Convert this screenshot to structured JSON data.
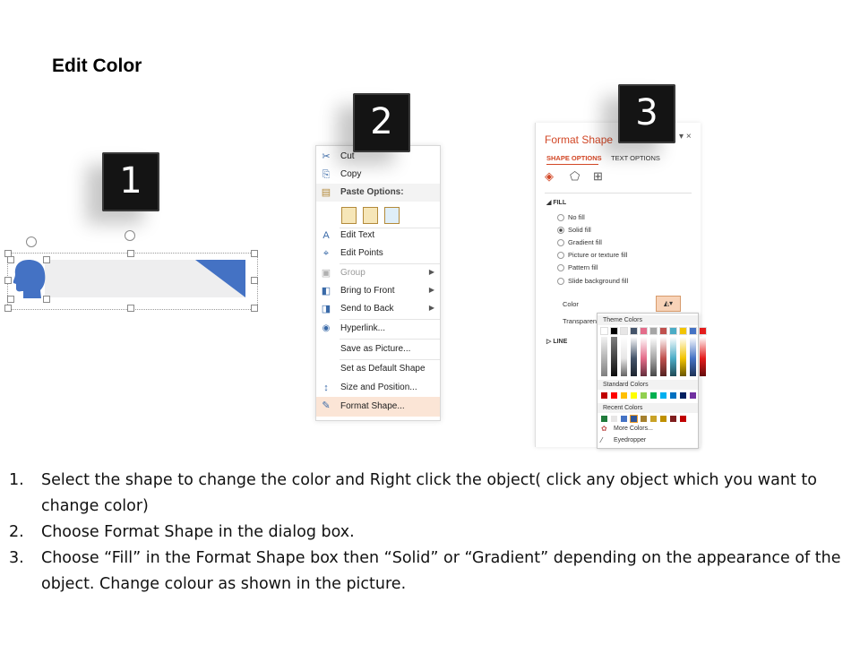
{
  "title": "Edit Color",
  "badges": [
    "1",
    "2",
    "3"
  ],
  "context_menu": {
    "items": [
      {
        "label": "Cut",
        "icon": "scissors-icon",
        "glyph": "✂"
      },
      {
        "label": "Copy",
        "icon": "copy-icon",
        "glyph": "⎘"
      },
      {
        "label": "Paste Options:",
        "icon": "paste-icon",
        "glyph": "📋"
      },
      {
        "label": "Edit Text",
        "icon": "edit-text-icon",
        "glyph": "A"
      },
      {
        "label": "Edit Points",
        "icon": "edit-points-icon",
        "glyph": "⌖"
      },
      {
        "label": "Group",
        "icon": "group-icon",
        "glyph": "▣"
      },
      {
        "label": "Bring to Front",
        "icon": "bring-front-icon",
        "glyph": "◧"
      },
      {
        "label": "Send to Back",
        "icon": "send-back-icon",
        "glyph": "◨"
      },
      {
        "label": "Hyperlink...",
        "icon": "hyperlink-icon",
        "glyph": "🌐"
      },
      {
        "label": "Save as Picture...",
        "icon": "",
        "glyph": ""
      },
      {
        "label": "Set as Default Shape",
        "icon": "",
        "glyph": ""
      },
      {
        "label": "Size and Position...",
        "icon": "size-position-icon",
        "glyph": "↕"
      },
      {
        "label": "Format Shape...",
        "icon": "format-shape-icon",
        "glyph": "✎"
      }
    ]
  },
  "format_pane": {
    "title": "Format Shape",
    "close": "×",
    "tabs": [
      "SHAPE OPTIONS",
      "TEXT OPTIONS"
    ],
    "fill_section": "FILL",
    "fill_options": [
      "No fill",
      "Solid fill",
      "Gradient fill",
      "Picture or texture fill",
      "Pattern fill",
      "Slide background fill"
    ],
    "selected_fill": "Solid fill",
    "color_label": "Color",
    "transparency_label": "Transparency",
    "line_section": "LINE"
  },
  "palette": {
    "theme_header": "Theme Colors",
    "standard_header": "Standard Colors",
    "recent_header": "Recent Colors",
    "more_colors": "More Colors...",
    "eyedropper": "Eyedropper",
    "theme_top": [
      "#ffffff",
      "#000000",
      "#e7e6e6",
      "#44546a",
      "#e46c8a",
      "#a5a5a5",
      "#c0504d",
      "#4bacc6",
      "#f2c400",
      "#4472c4",
      "#e41b1b"
    ],
    "standard": [
      "#c00000",
      "#ff0000",
      "#ffc000",
      "#ffff00",
      "#92d050",
      "#00b050",
      "#00b0f0",
      "#0070c0",
      "#002060",
      "#7030a0"
    ],
    "recent": [
      "#1f7a3a",
      "#e7e6e6",
      "#4472c4",
      "#2f5597",
      "#a5802e",
      "#c9a227",
      "#bf9000",
      "#7f1d1d",
      "#c00000"
    ]
  },
  "accent_colors": {
    "shape_blue": "#4472c4",
    "menu_highlight": "#fbe5d6",
    "pane_title": "#d24726"
  },
  "steps": [
    {
      "num": "1.",
      "text": "Select the shape to change the color and Right click the object( click any object which you want to change color)"
    },
    {
      "num": "2.",
      "text": "Choose Format Shape in the dialog box."
    },
    {
      "num": "3.",
      "text": "Choose “Fill” in the Format Shape box then “Solid” or “Gradient” depending on the appearance of the object. Change colour as shown in the picture."
    }
  ]
}
